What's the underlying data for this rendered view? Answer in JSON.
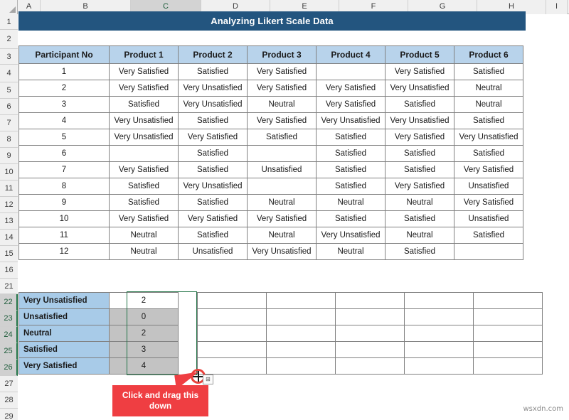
{
  "spreadsheet": {
    "column_headers": [
      "A",
      "B",
      "C",
      "D",
      "E",
      "F",
      "G",
      "H",
      "I"
    ],
    "selected_column": "C",
    "row_headers": [
      "1",
      "2",
      "3",
      "4",
      "5",
      "6",
      "7",
      "8",
      "9",
      "10",
      "11",
      "12",
      "13",
      "14",
      "15",
      "16",
      "21",
      "22",
      "23",
      "24",
      "25",
      "26",
      "27",
      "28",
      "29"
    ],
    "selected_rows": [
      "22",
      "23",
      "24",
      "25",
      "26"
    ]
  },
  "title": {
    "text": "Analyzing Likert Scale Data",
    "background": "#23557f",
    "color": "#ffffff"
  },
  "main_table": {
    "headers": [
      "Participant No",
      "Product 1",
      "Product 2",
      "Product 3",
      "Product 4",
      "Product 5",
      "Product 6"
    ],
    "header_background": "#b8d3eb",
    "rows": [
      [
        "1",
        "Very Satisfied",
        "Satisfied",
        "Very Satisfied",
        "",
        "Very Satisfied",
        "Satisfied"
      ],
      [
        "2",
        "Very Satisfied",
        "Very Unsatisfied",
        "Very Satisfied",
        "Very Satisfied",
        "Very Unsatisfied",
        "Neutral"
      ],
      [
        "3",
        "Satisfied",
        "Very Unsatisfied",
        "Neutral",
        "Very Satisfied",
        "Satisfied",
        "Neutral"
      ],
      [
        "4",
        "Very Unsatisfied",
        "Satisfied",
        "Very Satisfied",
        "Very Unsatisfied",
        "Very Unsatisfied",
        "Satisfied"
      ],
      [
        "5",
        "Very Unsatisfied",
        "Very Satisfied",
        "Satisfied",
        "Satisfied",
        "Very Satisfied",
        "Very Unsatisfied"
      ],
      [
        "6",
        "",
        "Satisfied",
        "",
        "Satisfied",
        "Satisfied",
        "Satisfied"
      ],
      [
        "7",
        "Very Satisfied",
        "Satisfied",
        "Unsatisfied",
        "Satisfied",
        "Satisfied",
        "Very Satisfied"
      ],
      [
        "8",
        "Satisfied",
        "Very Unsatisfied",
        "",
        "Satisfied",
        "Very Satisfied",
        "Unsatisfied"
      ],
      [
        "9",
        "Satisfied",
        "Satisfied",
        "Neutral",
        "Neutral",
        "Neutral",
        "Very Satisfied"
      ],
      [
        "10",
        "Very Satisfied",
        "Very Satisfied",
        "Very Satisfied",
        "Satisfied",
        "Satisfied",
        "Unsatisfied"
      ],
      [
        "11",
        "Neutral",
        "Satisfied",
        "Neutral",
        "Very Unsatisfied",
        "Neutral",
        "Satisfied"
      ],
      [
        "12",
        "Neutral",
        "Unsatisfied",
        "Very Unsatisfied",
        "Neutral",
        "Satisfied",
        ""
      ]
    ]
  },
  "summary_table": {
    "label_background": "#a8cbe8",
    "rows": [
      {
        "label": "Very Unsatisfied",
        "value": "2",
        "active": true
      },
      {
        "label": "Unsatisfied",
        "value": "0",
        "active": false
      },
      {
        "label": "Neutral",
        "value": "2",
        "active": false
      },
      {
        "label": "Satisfied",
        "value": "3",
        "active": false
      },
      {
        "label": "Very Satisfied",
        "value": "4",
        "active": false
      }
    ]
  },
  "selection": {
    "outline_color": "#217346",
    "fill_handle_icon": "plus-cursor-icon",
    "autofill_options_icon": "autofill-options-icon"
  },
  "callout": {
    "text": "Click and drag this down",
    "background": "#ef3e42",
    "color": "#ffffff"
  },
  "watermark": {
    "text": "wsxdn.com"
  }
}
